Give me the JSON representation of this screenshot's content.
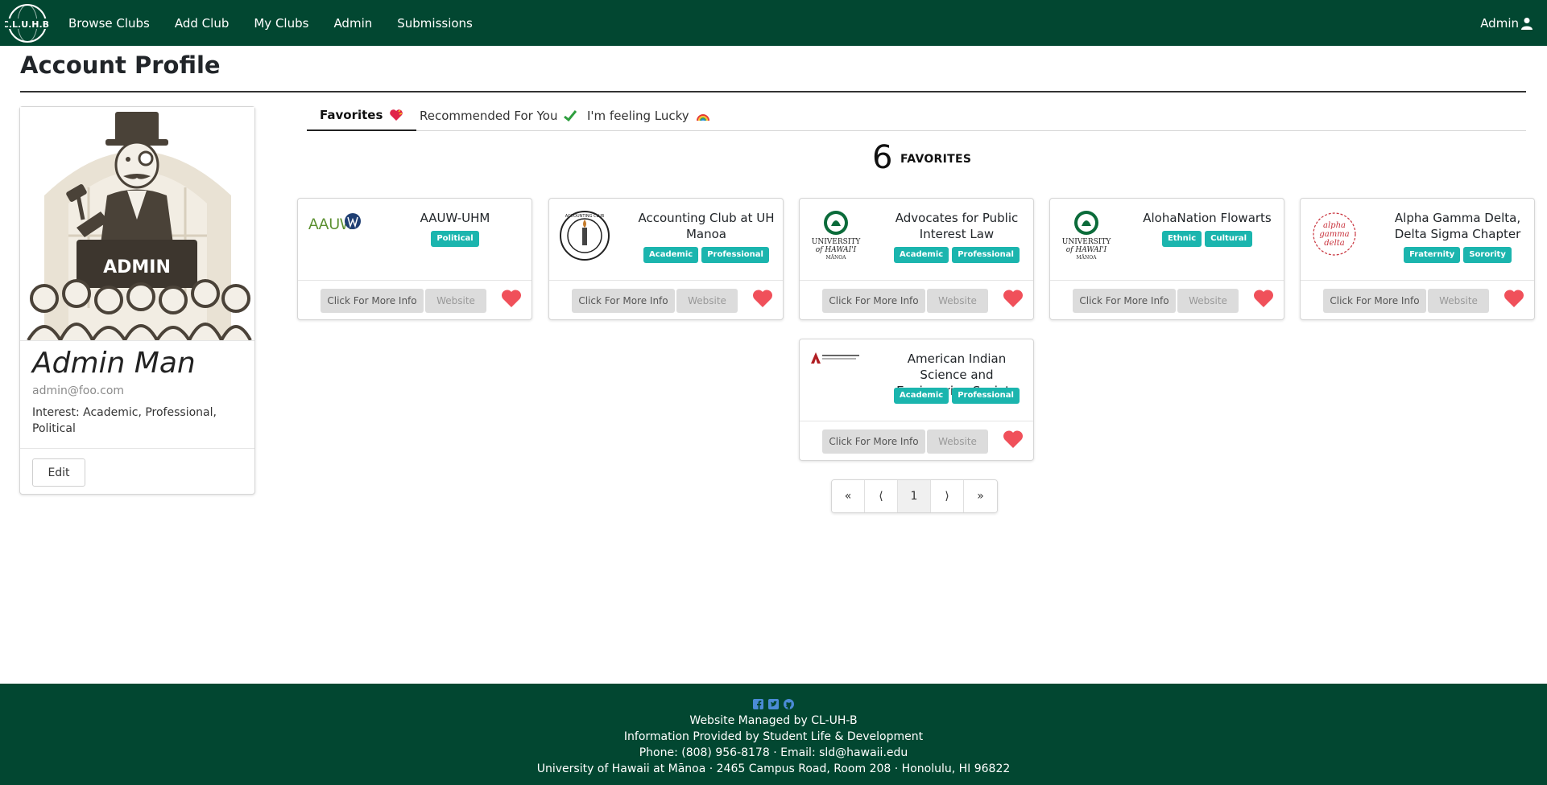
{
  "nav": {
    "brand_text": "C.L.U.H.B.",
    "links": [
      "Browse Clubs",
      "Add Club",
      "My Clubs",
      "Admin",
      "Submissions"
    ],
    "user": "Admin"
  },
  "page": {
    "title": "Account Profile"
  },
  "profile": {
    "badge_text": "ADMIN",
    "name": "Admin Man",
    "email": "admin@foo.com",
    "interest": "Interest: Academic, Professional, Political",
    "edit_label": "Edit"
  },
  "tabs": [
    {
      "label": "Favorites",
      "icon": "heart-emoji"
    },
    {
      "label": "Recommended For You",
      "icon": "check-emoji"
    },
    {
      "label": "I'm feeling Lucky",
      "icon": "rainbow-emoji"
    }
  ],
  "favorites": {
    "count": "6",
    "label": "FAVORITES"
  },
  "club_buttons": {
    "more_info": "Click For More Info",
    "website": "Website"
  },
  "clubs": [
    {
      "name": "AAUW-UHM",
      "tags": [
        "Political"
      ],
      "logo": "aauw-logo",
      "logo_text": "AAUW"
    },
    {
      "name": "Accounting Club at UH Manoa",
      "tags": [
        "Academic",
        "Professional"
      ],
      "logo": "accounting-seal-logo",
      "logo_text": "ACCOUNTING CLUB"
    },
    {
      "name": "Advocates for Public Interest Law",
      "tags": [
        "Academic",
        "Professional"
      ],
      "logo": "uh-manoa-logo",
      "logo_text": "UNIVERSITY of HAWAI'I MĀNOA"
    },
    {
      "name": "AlohaNation Flowarts",
      "tags": [
        "Ethnic",
        "Cultural"
      ],
      "logo": "uh-manoa-logo",
      "logo_text": "UNIVERSITY of HAWAI'I MĀNOA"
    },
    {
      "name": "Alpha Gamma Delta, Delta Sigma Chapter",
      "tags": [
        "Fraternity",
        "Sorority"
      ],
      "logo": "alpha-gamma-delta-logo",
      "logo_text": "alpha gamma delta"
    },
    {
      "name": "American Indian Science and Engineering Society",
      "tags": [
        "Academic",
        "Professional"
      ],
      "logo": "aises-logo",
      "logo_text": "AISES"
    }
  ],
  "pagination": [
    "«",
    "⟨",
    "1",
    "⟩",
    "»"
  ],
  "footer": {
    "social": [
      "facebook-icon",
      "twitter-icon",
      "github-icon"
    ],
    "lines": [
      "Website Managed by CL-UH-B",
      "Information Provided by Student Life & Development",
      "Phone: (808) 956-8178 · Email: sld@hawaii.edu",
      "University of Hawaii at Mānoa · 2465 Campus Road, Room 208 · Honolulu, HI 96822"
    ]
  },
  "colors": {
    "nav_bg": "#024731",
    "tag_bg": "#1bb5ae",
    "heart": "#f0505a"
  }
}
